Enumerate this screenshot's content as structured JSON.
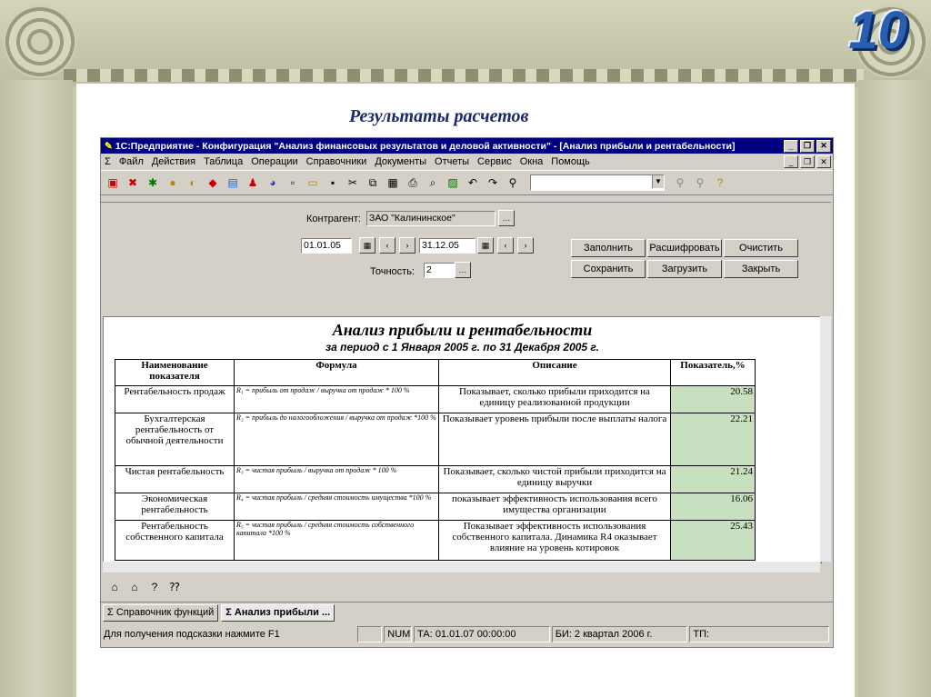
{
  "slide": {
    "badge": "10",
    "title": "Результаты расчетов"
  },
  "window": {
    "title": "1С:Предприятие - Конфигурация \"Анализ финансовых результатов и деловой активности\" - [Анализ прибыли и рентабельности]"
  },
  "menu": [
    "Файл",
    "Действия",
    "Таблица",
    "Операции",
    "Справочники",
    "Документы",
    "Отчеты",
    "Сервис",
    "Окна",
    "Помощь"
  ],
  "form": {
    "contragent_label": "Контрагент:",
    "contragent_value": "ЗАО \"Калининское\"",
    "date_from": "01.01.05",
    "date_to": "31.12.05",
    "precision_label": "Точность:",
    "precision_value": "2",
    "buttons": {
      "fill": "Заполнить",
      "decode": "Расшифровать",
      "clear": "Очистить",
      "save": "Сохранить",
      "load": "Загрузить",
      "close": "Закрыть"
    }
  },
  "report": {
    "title": "Анализ прибыли и рентабельности",
    "subtitle": "за период с 1 Января 2005 г. по 31 Декабря 2005 г.",
    "headers": [
      "Наименование показателя",
      "Формула",
      "Описание",
      "Показатель,%"
    ],
    "rows": [
      {
        "name": "Рентабельность продаж",
        "formula": "R₁ = прибыль от продаж / выручка от продаж * 100 %",
        "desc": "Показывает, сколько прибыли приходится на единицу реализованной продукции",
        "value": "20.58"
      },
      {
        "name": "Бухгалтерская рентабельность от обычной деятельности",
        "formula": "R₂ = прибыль до налогообложения / выручка от продаж *100 %",
        "desc": "Показывает уровень прибыли после выплаты налога",
        "value": "22.21"
      },
      {
        "name": "Чистая рентабельность",
        "formula": "R₃ = чистая прибыль / выручка от продаж * 100 %",
        "desc": "Показывает, сколько чистой прибыли приходится на единицу выручки",
        "value": "21.24"
      },
      {
        "name": "Экономическая рентабельность",
        "formula": "R₄ = чистая прибыль / средняя стоимость имущества *100 %",
        "desc": "показывает эффективность использования всего имущества организации",
        "value": "16.06"
      },
      {
        "name": "Рентабельность собственного капитала",
        "formula": "R₅ = чистая прибыль / средняя стоимость собственного капитала *100 %",
        "desc": "Показывает эффективность использования собственного капитала. Динамика R4 оказывает влияние на уровень котировок",
        "value": "25.43"
      }
    ]
  },
  "taskbar": [
    "Справочник функций",
    "Анализ прибыли ..."
  ],
  "status": {
    "hint": "Для получения подсказки нажмите F1",
    "num": "NUM",
    "ta": "ТА: 01.01.07 00:00:00",
    "bi": "БИ: 2 квартал 2006 г.",
    "tp": "ТП:"
  }
}
